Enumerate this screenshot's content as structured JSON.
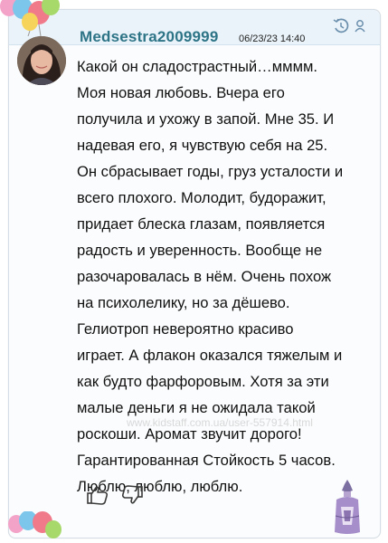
{
  "review": {
    "username": "Medsestra2009999",
    "timestamp": "06/23/23 14:40",
    "body": "Какой он сладострастный…мммм.\nМоя новая любовь. Вчера его\nполучила и ухожу в запой. Мне 35. И\nнадевая его, я чувствую себя на 25.\nОн сбрасывает годы, груз усталости и\nвсего плохого. Молодит, будоражит,\nпридает блеска глазам, появляется\nрадость и уверенность. Вообще не\nразочаровалась в нём. Очень похож\nна психолелику, но за дёшево.\nГелиотроп невероятно красиво\nиграет. А флакон оказался тяжелым и\nкак будто фарфоровым. Хотя за эти\nмалые деньги я не ожидала такой\nроскоши. Аромат звучит дорого!\nГарантированная Стойкость 5 часов.\nЛюблю, люблю, люблю.",
    "watermark": "www.kidstaff.com.ua/user-557914.html"
  },
  "icons": {
    "header_left": "history-icon",
    "header_right": "user-icon",
    "like": "thumbs-up-icon",
    "dislike": "thumbs-down-icon",
    "decoration": "balloons-icon",
    "product": "perfume-bottle-icon"
  },
  "colors": {
    "username": "#2e7487",
    "header_background": "#e9f3f9",
    "icon_blue": "#6b8fad"
  }
}
